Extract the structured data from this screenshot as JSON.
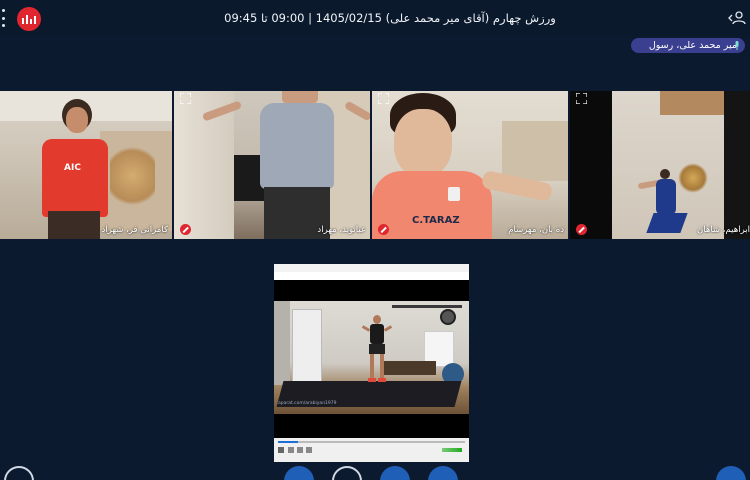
{
  "header": {
    "title": "ورزش چهارم (آقای میر محمد علی) 1405/02/15 | 09:00 تا 09:45",
    "presenter": "میر محمد علی، رسول"
  },
  "participants": [
    {
      "name": "کامرانی فر، شهراد"
    },
    {
      "name": "عباتوند، مهراد"
    },
    {
      "name": "ده بان، مهرسام"
    },
    {
      "name": "ابراهیم، شاهان"
    }
  ],
  "shared_screen": {
    "watermark": "aparat.com/arabiyan1979"
  },
  "colors": {
    "background": "#0b1a2e",
    "brand": "#e0272f",
    "chip": "#3a3f8f",
    "toolbar_button": "#1f5fb8"
  }
}
